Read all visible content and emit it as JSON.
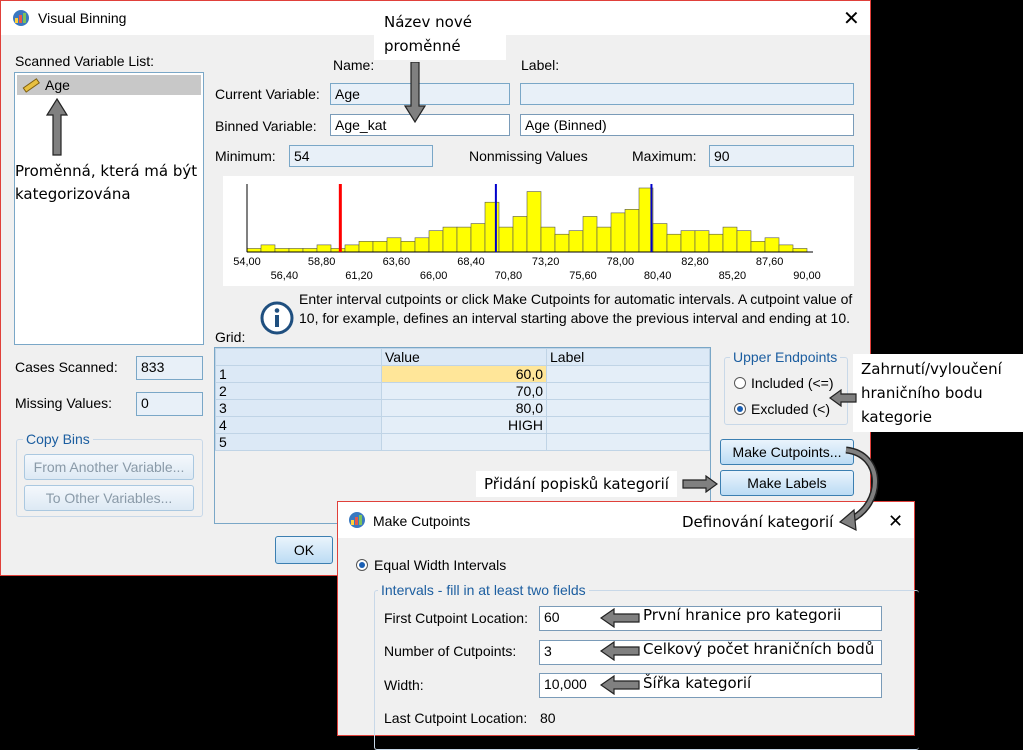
{
  "main_dialog": {
    "title": "Visual Binning",
    "scanned_list_label": "Scanned Variable List:",
    "scanned_items": [
      "Age"
    ],
    "name_header": "Name:",
    "label_header": "Label:",
    "current_variable_label": "Current Variable:",
    "current_variable_name": "Age",
    "current_variable_desc": "",
    "binned_variable_label": "Binned Variable:",
    "binned_variable_name": "Age_kat",
    "binned_variable_desc": "Age (Binned)",
    "minimum_label": "Minimum:",
    "minimum_value": "54",
    "nonmissing_label": "Nonmissing Values",
    "maximum_label": "Maximum:",
    "maximum_value": "90",
    "info_text": "Enter interval cutpoints or click Make Cutpoints for automatic intervals. A cutpoint value of 10, for example, defines an interval starting above the previous interval and ending at 10.",
    "grid_label": "Grid:",
    "grid_headers": [
      "",
      "Value",
      "Label"
    ],
    "grid_rows": [
      {
        "n": "1",
        "value": "60,0",
        "label": ""
      },
      {
        "n": "2",
        "value": "70,0",
        "label": ""
      },
      {
        "n": "3",
        "value": "80,0",
        "label": ""
      },
      {
        "n": "4",
        "value": "HIGH",
        "label": ""
      },
      {
        "n": "5",
        "value": "",
        "label": ""
      }
    ],
    "cases_scanned_label": "Cases Scanned:",
    "cases_scanned_value": "833",
    "missing_values_label": "Missing Values:",
    "missing_values_value": "0",
    "copy_bins_legend": "Copy Bins",
    "from_another_button": "From Another Variable...",
    "to_other_button": "To Other Variables...",
    "upper_endpoints_legend": "Upper Endpoints",
    "included_label": "Included (<=)",
    "excluded_label": "Excluded (<)",
    "make_cutpoints_button": "Make Cutpoints...",
    "make_labels_button": "Make Labels",
    "ok_button": "OK"
  },
  "cutpoints_dialog": {
    "title": "Make Cutpoints",
    "equal_width_label": "Equal Width Intervals",
    "intervals_legend": "Intervals - fill in at least two fields",
    "first_cutpoint_label": "First Cutpoint Location:",
    "first_cutpoint_value": "60",
    "number_cutpoints_label": "Number of Cutpoints:",
    "number_cutpoints_value": "3",
    "width_label": "Width:",
    "width_value": "10,000",
    "last_cutpoint_label": "Last Cutpoint Location:",
    "last_cutpoint_value": "80"
  },
  "annotations": {
    "new_variable_name": "Název nové proměnné",
    "variable_to_categorize": "Proměnná, která má být kategorizována",
    "endpoint_inclusion": "Zahrnutí/vyloučení hraničního bodu kategorie",
    "add_labels": "Přidání popisků kategorií",
    "define_categories": "Definování kategorií",
    "first_boundary": "První hranice pro kategorii",
    "total_cutpoints": "Celkový počet hraničních bodů",
    "category_width": "Šířka kategorií"
  },
  "histogram": {
    "bar_color": "#ffff00",
    "cutpoint_colors": [
      "#ff0000",
      "#0000cc",
      "#0000cc"
    ],
    "cutpoints": [
      60,
      70,
      80
    ],
    "x_range": [
      54,
      90
    ],
    "tick_labels_top": [
      "54,00",
      "58,80",
      "63,60",
      "68,40",
      "73,20",
      "78,00",
      "82,80",
      "87,60"
    ],
    "tick_labels_bottom": [
      "56,40",
      "61,20",
      "66,00",
      "70,80",
      "75,60",
      "80,40",
      "85,20",
      "90,00"
    ],
    "bins": [
      1,
      2,
      1,
      1,
      1,
      2,
      1,
      2,
      3,
      3,
      4,
      3,
      4,
      6,
      7,
      7,
      8,
      14,
      7,
      10,
      17,
      7,
      5,
      6,
      10,
      7,
      11,
      12,
      18,
      8,
      5,
      6,
      6,
      5,
      7,
      6,
      3,
      4,
      2,
      1
    ]
  }
}
